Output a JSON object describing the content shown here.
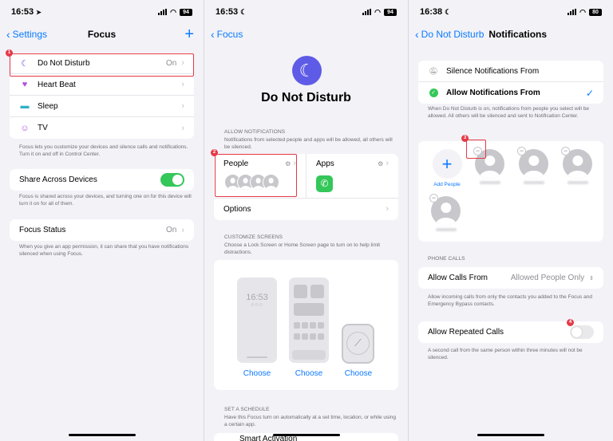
{
  "screen1": {
    "time": "16:53",
    "battery": "94",
    "back_label": "Settings",
    "title": "Focus",
    "items": [
      {
        "label": "Do Not Disturb",
        "value": "On",
        "icon": "moon-icon",
        "color": "#5e5ce6"
      },
      {
        "label": "Heart Beat",
        "value": "",
        "icon": "heart-icon",
        "color": "#af52de"
      },
      {
        "label": "Sleep",
        "value": "",
        "icon": "bed-icon",
        "color": "#30b0c7"
      },
      {
        "label": "TV",
        "value": "",
        "icon": "smiley-icon",
        "color": "#af52de"
      }
    ],
    "focus_note": "Focus lets you customize your devices and silence calls and notifications. Turn it on and off in Control Center.",
    "share_label": "Share Across Devices",
    "share_on": true,
    "share_note": "Focus is shared across your devices, and turning one on for this device will turn it on for all of them.",
    "status_label": "Focus Status",
    "status_value": "On",
    "status_note": "When you give an app permission, it can share that you have notifications silenced when using Focus.",
    "badge": "1"
  },
  "screen2": {
    "time": "16:53",
    "battery": "94",
    "back_label": "Focus",
    "heading": "Do Not Disturb",
    "allow_header": "ALLOW NOTIFICATIONS",
    "allow_note": "Notifications from selected people and apps will be allowed, all others will be silenced.",
    "people_label": "People",
    "apps_label": "Apps",
    "options_label": "Options",
    "customize_header": "CUSTOMIZE SCREENS",
    "customize_note": "Choose a Lock Screen or Home Screen page to turn on to help limit distractions.",
    "lock_time": "16:53",
    "choose_labels": [
      "Choose",
      "Choose",
      "Choose"
    ],
    "schedule_header": "SET A SCHEDULE",
    "schedule_note": "Have this Focus turn on automatically at a set time, location, or while using a certain app.",
    "smart_label": "Smart Activation",
    "badge": "2"
  },
  "screen3": {
    "time": "16:38",
    "battery": "80",
    "back_label": "Do Not Disturb",
    "title": "Notifications",
    "silence_label": "Silence Notifications From",
    "allow_label": "Allow Notifications From",
    "allow_note": "When Do Not Disturb is on, notifications from people you select will be allowed. All others will be silenced and sent to Notification Center.",
    "add_people_label": "Add People",
    "phone_calls_header": "PHONE CALLS",
    "allow_calls_label": "Allow Calls From",
    "allow_calls_value": "Allowed People Only",
    "calls_note": "Allow incoming calls from only the contacts you added to the Focus and Emergency Bypass contacts.",
    "repeated_label": "Allow Repeated Calls",
    "repeated_on": false,
    "repeated_note": "A second call from the same person within three minutes will not be silenced.",
    "badge_minus": "3",
    "badge_toggle": "4"
  },
  "colors": {
    "accent": "#0a7aff",
    "highlight": "#e53946",
    "toggle_on": "#34c759"
  }
}
